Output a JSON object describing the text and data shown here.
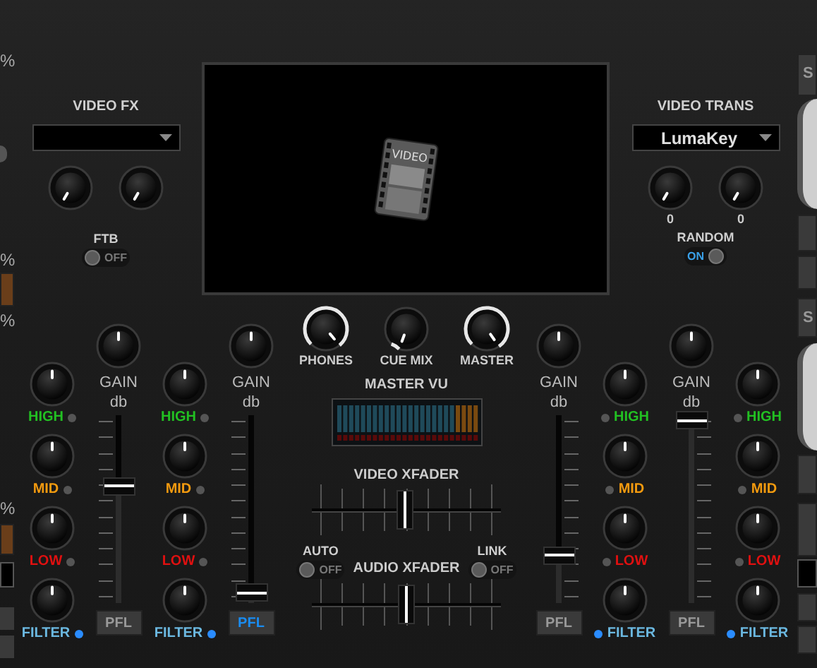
{
  "left_edge": {
    "percent_labels": [
      "%",
      "%",
      "%",
      "%"
    ]
  },
  "video_fx": {
    "label": "VIDEO FX"
  },
  "ftb": {
    "label": "FTB",
    "state_text": "OFF",
    "on": false
  },
  "video_screen": {
    "icon_caption": "VIDEO"
  },
  "video_trans": {
    "label": "VIDEO TRANS",
    "value": "LumaKey",
    "knob_readings": [
      "0",
      "0"
    ]
  },
  "random": {
    "label": "RANDOM",
    "state_text": "ON",
    "on": true
  },
  "right_edge": {
    "button_labels": [
      "S",
      "S"
    ]
  },
  "monitor_knobs": [
    {
      "label": "PHONES"
    },
    {
      "label": "CUE MIX"
    },
    {
      "label": "MASTER"
    }
  ],
  "master_vu": {
    "label": "MASTER VU"
  },
  "video_xfader": {
    "label": "VIDEO XFADER",
    "level": 0.49
  },
  "auto": {
    "label": "AUTO",
    "state_text": "OFF",
    "on": false
  },
  "audio_xfader": {
    "label": "AUDIO XFADER",
    "level": 0.5
  },
  "link": {
    "label": "LINK",
    "state_text": "OFF",
    "on": false
  },
  "channels": [
    {
      "gain_label": "GAIN",
      "gain_unit": "db",
      "eq": [
        {
          "label": "HIGH",
          "color": "#22c022",
          "kill": false
        },
        {
          "label": "MID",
          "color": "#f29a0f",
          "kill": false
        },
        {
          "label": "LOW",
          "color": "#e01010",
          "kill": false
        }
      ],
      "filter": {
        "label": "FILTER",
        "color": "#6bb8e0",
        "on": true
      },
      "level": 0.62,
      "pfl": {
        "label": "PFL",
        "on": false
      }
    },
    {
      "gain_label": "GAIN",
      "gain_unit": "db",
      "eq": [
        {
          "label": "HIGH",
          "color": "#22c022",
          "kill": false
        },
        {
          "label": "MID",
          "color": "#f29a0f",
          "kill": false
        },
        {
          "label": "LOW",
          "color": "#e01010",
          "kill": false
        }
      ],
      "filter": {
        "label": "FILTER",
        "color": "#6bb8e0",
        "on": true
      },
      "level": 0.05,
      "pfl": {
        "label": "PFL",
        "on": true
      }
    },
    {
      "gain_label": "GAIN",
      "gain_unit": "db",
      "eq": [
        {
          "label": "HIGH",
          "color": "#22c022",
          "kill": false
        },
        {
          "label": "MID",
          "color": "#f29a0f",
          "kill": false
        },
        {
          "label": "LOW",
          "color": "#e01010",
          "kill": false
        }
      ],
      "filter": {
        "label": "FILTER",
        "color": "#6bb8e0",
        "on": true
      },
      "level": 0.25,
      "pfl": {
        "label": "PFL",
        "on": false
      }
    },
    {
      "gain_label": "GAIN",
      "gain_unit": "db",
      "eq": [
        {
          "label": "HIGH",
          "color": "#22c022",
          "kill": false
        },
        {
          "label": "MID",
          "color": "#f29a0f",
          "kill": false
        },
        {
          "label": "LOW",
          "color": "#e01010",
          "kill": false
        }
      ],
      "filter": {
        "label": "FILTER",
        "color": "#6bb8e0",
        "on": true
      },
      "level": 0.97,
      "pfl": {
        "label": "PFL",
        "on": false
      }
    }
  ]
}
